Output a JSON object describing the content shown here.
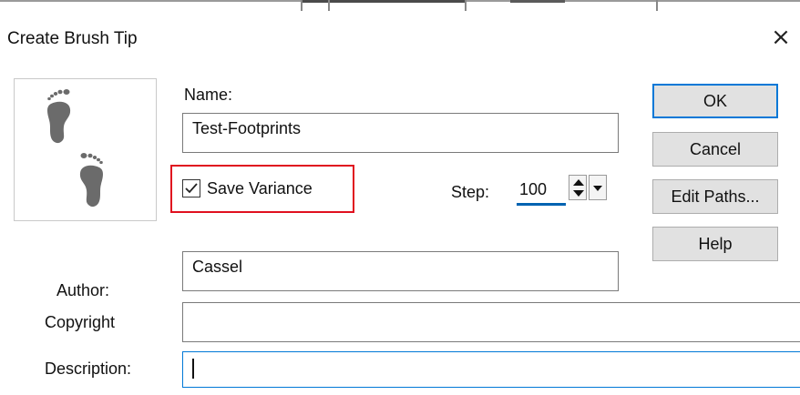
{
  "dialog": {
    "title": "Create Brush Tip",
    "close_glyph": "×"
  },
  "preview": {
    "image": "footprints-icon"
  },
  "name": {
    "label": "Name:",
    "value": "Test-Footprints"
  },
  "save_variance": {
    "label": "Save Variance",
    "checked": true
  },
  "step": {
    "label": "Step:",
    "value": "100"
  },
  "author": {
    "label": "Author:",
    "value": "Cassel"
  },
  "copyright": {
    "label": "Copyright",
    "value": ""
  },
  "description": {
    "label": "Description:",
    "value": ""
  },
  "buttons": {
    "ok": "OK",
    "cancel": "Cancel",
    "edit_paths": "Edit Paths...",
    "help": "Help"
  },
  "colors": {
    "accent": "#0078d7",
    "highlight": "#e0101f",
    "footprint": "#6b6b6b"
  }
}
